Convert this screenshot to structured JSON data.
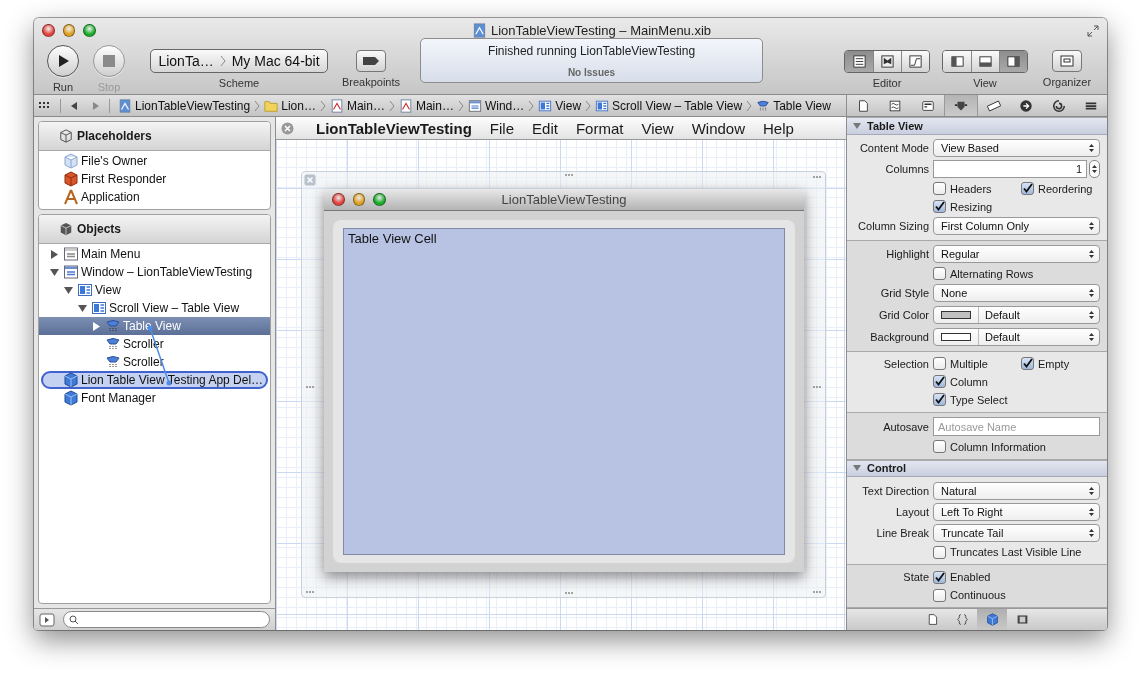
{
  "window": {
    "title": "LionTableViewTesting – MainMenu.xib"
  },
  "toolbar": {
    "run": {
      "label": "Run",
      "disabled": false
    },
    "stop": {
      "label": "Stop",
      "disabled": true
    },
    "scheme": {
      "target": "LionTa…",
      "destination": "My Mac 64-bit",
      "label": "Scheme"
    },
    "breakpoints": {
      "label": "Breakpoints"
    },
    "activity": {
      "status": "Finished running LionTableViewTesting",
      "issues": "No Issues"
    },
    "editor": {
      "label": "Editor",
      "buttons": [
        {
          "kind": "standard",
          "selected": true
        },
        {
          "kind": "assistant",
          "selected": false
        },
        {
          "kind": "version",
          "selected": false
        }
      ]
    },
    "view": {
      "label": "View",
      "buttons": [
        {
          "kind": "navigator",
          "selected": false
        },
        {
          "kind": "debug",
          "selected": false
        },
        {
          "kind": "utilities",
          "selected": true
        }
      ]
    },
    "organizer": {
      "label": "Organizer"
    }
  },
  "breadcrumbs": [
    {
      "label": "LionTableViewTesting",
      "kind": "project"
    },
    {
      "label": "Lion…",
      "kind": "folder"
    },
    {
      "label": "Main…",
      "kind": "xib"
    },
    {
      "label": "Main…",
      "kind": "xib"
    },
    {
      "label": "Wind…",
      "kind": "window"
    },
    {
      "label": "View",
      "kind": "view"
    },
    {
      "label": "Scroll View – Table View",
      "kind": "view"
    },
    {
      "label": "Table View",
      "kind": "table"
    }
  ],
  "inspector_tabs": [
    {
      "kind": "file",
      "selected": false
    },
    {
      "kind": "help",
      "selected": false
    },
    {
      "kind": "identity",
      "selected": false
    },
    {
      "kind": "attributes",
      "selected": true
    },
    {
      "kind": "size",
      "selected": false
    },
    {
      "kind": "connections",
      "selected": false
    },
    {
      "kind": "bindings",
      "selected": false
    },
    {
      "kind": "effects",
      "selected": false
    }
  ],
  "navigator": {
    "placeholders": {
      "title": "Placeholders",
      "items": [
        {
          "label": "File's Owner",
          "kind": "owner"
        },
        {
          "label": "First Responder",
          "kind": "responder"
        },
        {
          "label": "Application",
          "kind": "application"
        }
      ]
    },
    "objects": {
      "title": "Objects",
      "items": [
        {
          "label": "Main Menu",
          "kind": "menu",
          "expanded": false,
          "selected": false
        },
        {
          "label": "Window – LionTableViewTesting",
          "kind": "window",
          "expanded": true,
          "selected": false,
          "children": [
            {
              "label": "View",
              "kind": "view",
              "expanded": true,
              "selected": false,
              "children": [
                {
                  "label": "Scroll View – Table View",
                  "kind": "view",
                  "expanded": true,
                  "selected": false,
                  "children": [
                    {
                      "label": "Table View",
                      "kind": "table",
                      "expanded": false,
                      "selected": true
                    },
                    {
                      "label": "Scroller",
                      "kind": "table",
                      "selected": false
                    },
                    {
                      "label": "Scroller",
                      "kind": "table",
                      "selected": false
                    }
                  ]
                }
              ]
            }
          ]
        },
        {
          "label": "Lion Table View Testing App Del…",
          "kind": "object",
          "selected": false,
          "drop_target": true
        },
        {
          "label": "Font Manager",
          "kind": "object",
          "selected": false
        }
      ]
    }
  },
  "canvas": {
    "menu_bar": {
      "app_name": "LionTableViewTesting",
      "items": [
        "File",
        "Edit",
        "Format",
        "View",
        "Window",
        "Help"
      ]
    },
    "window": {
      "title": "LionTableViewTesting",
      "cell_text": "Table View Cell"
    }
  },
  "inspector": {
    "sections": [
      {
        "title": "Table View",
        "expanded": true,
        "groups": [
          [
            {
              "kind": "popup",
              "label": "Content Mode",
              "value": "View Based"
            },
            {
              "kind": "stepper",
              "label": "Columns",
              "value": "1"
            },
            {
              "kind": "checks",
              "checks": [
                {
                  "label": "Headers",
                  "checked": false
                },
                {
                  "label": "Reordering",
                  "checked": true
                }
              ]
            },
            {
              "kind": "checks",
              "checks": [
                {
                  "label": "Resizing",
                  "checked": true
                }
              ]
            },
            {
              "kind": "popup",
              "label": "Column Sizing",
              "value": "First Column Only"
            }
          ],
          [
            {
              "kind": "popup",
              "label": "Highlight",
              "value": "Regular"
            },
            {
              "kind": "checks",
              "checks": [
                {
                  "label": "Alternating Rows",
                  "checked": false
                }
              ]
            },
            {
              "kind": "popup",
              "label": "Grid Style",
              "value": "None"
            },
            {
              "kind": "color",
              "label": "Grid Color",
              "color": "#c0c0c0",
              "value": "Default"
            },
            {
              "kind": "color",
              "label": "Background",
              "color": "#ffffff",
              "value": "Default"
            }
          ],
          [
            {
              "kind": "checks",
              "label": "Selection",
              "checks": [
                {
                  "label": "Multiple",
                  "checked": false
                },
                {
                  "label": "Empty",
                  "checked": true
                }
              ]
            },
            {
              "kind": "checks",
              "checks": [
                {
                  "label": "Column",
                  "checked": true
                }
              ]
            },
            {
              "kind": "checks",
              "checks": [
                {
                  "label": "Type Select",
                  "checked": true
                }
              ]
            }
          ],
          [
            {
              "kind": "field",
              "label": "Autosave",
              "placeholder": "Autosave Name"
            },
            {
              "kind": "checks",
              "checks": [
                {
                  "label": "Column Information",
                  "checked": false
                }
              ]
            }
          ]
        ]
      },
      {
        "title": "Control",
        "expanded": true,
        "groups": [
          [
            {
              "kind": "popup",
              "label": "Text Direction",
              "value": "Natural"
            },
            {
              "kind": "popup",
              "label": "Layout",
              "value": "Left To Right"
            },
            {
              "kind": "popup",
              "label": "Line Break",
              "value": "Truncate Tail"
            },
            {
              "kind": "checks",
              "checks": [
                {
                  "label": "Truncates Last Visible Line",
                  "checked": false
                }
              ]
            }
          ],
          [
            {
              "kind": "checks",
              "label": "State",
              "checks": [
                {
                  "label": "Enabled",
                  "checked": true
                }
              ]
            },
            {
              "kind": "checks",
              "checks": [
                {
                  "label": "Continuous",
                  "checked": false
                }
              ]
            }
          ]
        ]
      }
    ]
  },
  "library_tabs": [
    {
      "kind": "file",
      "selected": false
    },
    {
      "kind": "code",
      "selected": false
    },
    {
      "kind": "object",
      "selected": true
    },
    {
      "kind": "media",
      "selected": false
    }
  ]
}
